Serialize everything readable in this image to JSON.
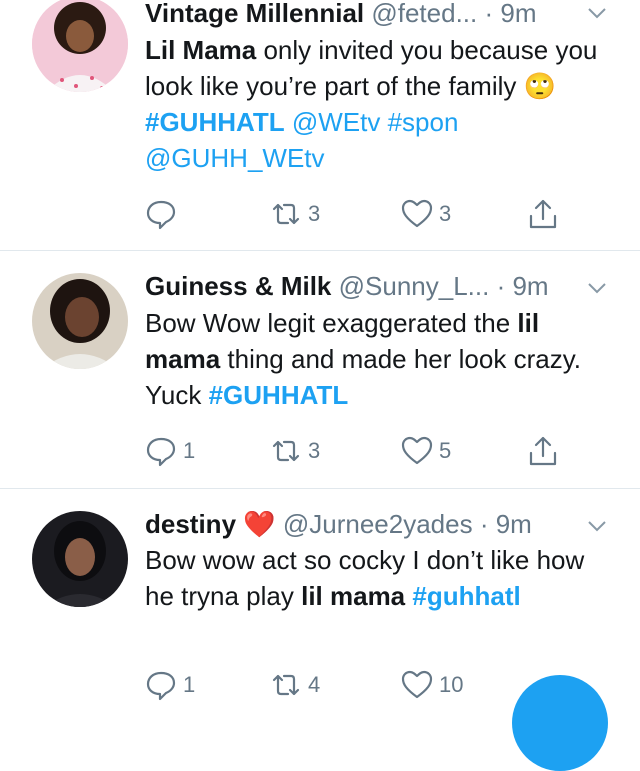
{
  "tweets": [
    {
      "name": "Vintage Millennial",
      "handle": "@feted...",
      "time": "· 9m",
      "text": [
        {
          "t": "Lil Mama",
          "k": "bold"
        },
        {
          "t": " only invited you because you look like you’re part of the family ",
          "k": "plain"
        },
        {
          "t": "🙄",
          "k": "plain"
        },
        {
          "t": " #GUHHATL",
          "k": "tag"
        },
        {
          "t": " @WEtv #spon @GUHH_WEtv",
          "k": "mention"
        }
      ],
      "reply_count": "",
      "retweet_count": "3",
      "like_count": "3"
    },
    {
      "name": "Guiness & Milk",
      "handle": "@Sunny_L...",
      "time": "· 9m",
      "text": [
        {
          "t": "Bow Wow legit exaggerated the ",
          "k": "plain"
        },
        {
          "t": "lil mama",
          "k": "bold"
        },
        {
          "t": " thing and made her look crazy. Yuck ",
          "k": "plain"
        },
        {
          "t": "#GUHHATL",
          "k": "tag"
        }
      ],
      "reply_count": "1",
      "retweet_count": "3",
      "like_count": "5"
    },
    {
      "name": "destiny ❤️",
      "handle": "@Jurnee2yades",
      "time": "· 9m",
      "text": [
        {
          "t": "Bow wow act so cocky I don’t like how he tryna play ",
          "k": "plain"
        },
        {
          "t": "lil mama",
          "k": "bold"
        },
        {
          "t": " ",
          "k": "plain"
        },
        {
          "t": "#guhhatl",
          "k": "tag"
        }
      ],
      "reply_count": "1",
      "retweet_count": "4",
      "like_count": "10"
    }
  ],
  "icons": {
    "reply": "reply-icon",
    "retweet": "retweet-icon",
    "like": "heart-icon",
    "share": "share-icon",
    "caret": "chevron-down-icon"
  },
  "colors": {
    "accent": "#1da1f2",
    "muted": "#657786",
    "divider": "#e1e8ed"
  }
}
